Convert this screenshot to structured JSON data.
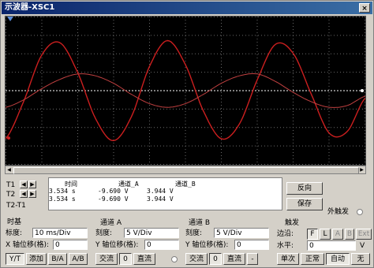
{
  "window": {
    "title": "示波器-XSC1",
    "close": "×"
  },
  "readout": {
    "headers": {
      "time": "时间",
      "ch_a": "通道_A",
      "ch_b": "通道_B"
    },
    "rows": [
      {
        "label": "T1",
        "time": "3.534 s",
        "a": "-9.690 V",
        "b": "3.944 V"
      },
      {
        "label": "T2",
        "time": "3.534 s",
        "a": "-9.690 V",
        "b": "3.944 V"
      },
      {
        "label": "T2-T1",
        "time": "",
        "a": "",
        "b": ""
      }
    ]
  },
  "buttons": {
    "reverse": "反向",
    "save": "保存",
    "ext_trigger": "外触发"
  },
  "timebase": {
    "title": "时基",
    "scale_label": "标度:",
    "scale_value": "10 ms/Div",
    "xpos_label": "X 轴位移(格):",
    "xpos_value": "0",
    "modes": [
      "Y/T",
      "添加",
      "B/A",
      "A/B"
    ]
  },
  "channel_a": {
    "title": "通道 A",
    "scale_label": "刻度:",
    "scale_value": "5 V/Div",
    "ypos_label": "Y 轴位移(格):",
    "ypos_value": "0",
    "coupling": [
      "交流",
      "0",
      "直流"
    ]
  },
  "channel_b": {
    "title": "通道 B",
    "scale_label": "刻度:",
    "scale_value": "5 V/Div",
    "ypos_label": "Y 轴位移(格):",
    "ypos_value": "0",
    "coupling": [
      "交流",
      "0",
      "直流",
      "-"
    ]
  },
  "trigger": {
    "title": "触发",
    "edge_label": "边沿:",
    "edge_buttons": [
      "F",
      "L",
      "A",
      "B",
      "Ext"
    ],
    "level_label": "水平:",
    "level_value": "0",
    "level_unit": "V",
    "modes": [
      "单次",
      "正常",
      "自动",
      "无"
    ]
  },
  "colors": {
    "screen": "#000000",
    "trace_a": "#cc1f1f",
    "trace_b": "#c04040",
    "grid": "#6a6a6a",
    "cursor": "#ffffff"
  },
  "chart_data": {
    "type": "line",
    "title": "",
    "xlabel": "",
    "ylabel": "",
    "x_divisions": 10,
    "y_divisions": 8,
    "series": [
      {
        "x": [
          0,
          0.5,
          1,
          1.5,
          2,
          2.5,
          3,
          3.5,
          4,
          4.5,
          5,
          5.5,
          6,
          6.5,
          7,
          7.5,
          8,
          8.5,
          9,
          9.5,
          10
        ],
        "y": [
          -2.6,
          -0.6,
          1.9,
          2.6,
          1.0,
          -1.5,
          -2.7,
          -1.4,
          1.3,
          2.7,
          1.4,
          -1.1,
          -2.6,
          -1.8,
          0.6,
          2.5,
          2.0,
          -0.2,
          -2.3,
          -2.2,
          -0.4
        ]
      },
      {
        "x": [
          0,
          0.5,
          1,
          1.5,
          2,
          2.5,
          3,
          3.5,
          4,
          4.5,
          5,
          5.5,
          6,
          6.5,
          7,
          7.5,
          8,
          8.5,
          9,
          9.5,
          10
        ],
        "y": [
          -0.9,
          -0.5,
          0.1,
          0.6,
          0.9,
          0.8,
          0.4,
          -0.2,
          -0.7,
          -0.9,
          -0.7,
          -0.2,
          0.4,
          0.8,
          0.9,
          0.5,
          -0.1,
          -0.6,
          -0.9,
          -0.8,
          -0.3
        ]
      }
    ]
  }
}
